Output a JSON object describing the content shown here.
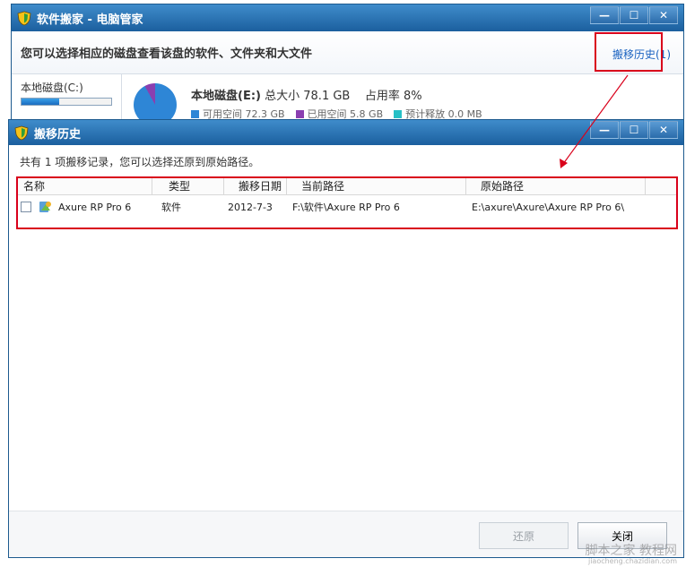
{
  "main_window": {
    "title": "软件搬家 - 电脑管家",
    "header_text": "您可以选择相应的磁盘查看该盘的软件、文件夹和大文件",
    "history_link": "搬移历史(1)",
    "window_buttons": [
      "—",
      "☐",
      "✕"
    ],
    "drive_tab": {
      "label": "本地磁盘(C:)",
      "usage_fraction": 0.42
    },
    "selected_drive": {
      "name": "本地磁盘(E:)",
      "total_label": "总大小",
      "total_value": "78.1 GB",
      "usage_label": "占用率",
      "usage_value": "8%",
      "legend": [
        {
          "label": "可用空间 72.3 GB",
          "color": "#2e86d6"
        },
        {
          "label": "已用空间 5.8 GB",
          "color": "#8a3fb0"
        },
        {
          "label": "预计释放 0.0 MB",
          "color": "#27c0c6"
        }
      ]
    }
  },
  "dialog": {
    "title": "搬移历史",
    "description": "共有 1 项搬移记录，您可以选择还原到原始路径。",
    "window_buttons": [
      "—",
      "☐",
      "✕"
    ],
    "columns": [
      "名称",
      "类型",
      "搬移日期",
      "当前路径",
      "原始路径"
    ],
    "rows": [
      {
        "name": "Axure RP Pro 6",
        "type": "软件",
        "date": "2012-7-3",
        "current_path": "F:\\软件\\Axure RP Pro 6",
        "original_path": "E:\\axure\\Axure\\Axure RP Pro 6\\",
        "checked": false
      }
    ],
    "restore_button": "还原",
    "close_button": "关闭"
  },
  "watermark": {
    "line1": "脚本之家 教程网",
    "line2": "jiaocheng.chazidian.com"
  }
}
